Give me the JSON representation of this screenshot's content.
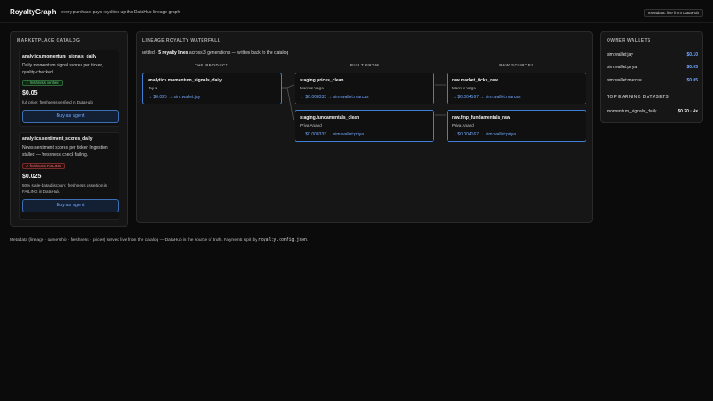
{
  "header": {
    "brand": "RoyaltyGraph",
    "tagline": "every purchase pays royalties up the DataHub lineage graph",
    "live_badge": "metadata: live from DataHub"
  },
  "catalog": {
    "title": "MARKETPLACE CATALOG",
    "items": [
      {
        "name": "analytics.momentum_signals_daily",
        "description": "Daily momentum signal scores per ticker, quality-checked.",
        "badge": "✓ freshness verified",
        "price": "$0.05",
        "price_note": "full price: freshness verified in DataHub",
        "button": "Buy as agent"
      },
      {
        "name": "analytics.sentiment_scores_daily",
        "description": "News-sentiment scores per ticker. Ingestion stalled — freshness check failing.",
        "badge": "✗ freshness FAILING",
        "price": "$0.025",
        "price_note": "50% stale-data discount: freshness assertion is FAILING in DataHub.",
        "button": "Buy as agent"
      }
    ]
  },
  "waterfall": {
    "title": "LINEAGE ROYALTY WATERFALL",
    "settled_prefix": "settled · ",
    "settled_bold": "5 royalty lines",
    "settled_suffix": " across 3 generations — written back to the catalog",
    "columns": [
      "THE PRODUCT",
      "BUILT FROM",
      "RAW SOURCES"
    ],
    "nodes": [
      {
        "name": "analytics.momentum_signals_daily",
        "owner": "Jay K",
        "payout": "→ $0.025 → sim:wallet:jay"
      },
      {
        "name": "staging.prices_clean",
        "owner": "Marcus Vega",
        "payout": "→ $0.008333 → sim:wallet:marcus"
      },
      {
        "name": "staging.fundamentals_clean",
        "owner": "Priya Anand",
        "payout": "→ $0.008333 → sim:wallet:priya"
      },
      {
        "name": "raw.market_ticks_raw",
        "owner": "Marcus Vega",
        "payout": "→ $0.004167 → sim:wallet:marcus"
      },
      {
        "name": "raw.fmp_fundamentals_raw",
        "owner": "Priya Anand",
        "payout": "→ $0.004167 → sim:wallet:priya"
      }
    ]
  },
  "owners": {
    "title": "OWNER WALLETS",
    "wallets": [
      {
        "name": "sim:wallet:jay",
        "amount": "$0.10"
      },
      {
        "name": "sim:wallet:priya",
        "amount": "$0.05"
      },
      {
        "name": "sim:wallet:marcus",
        "amount": "$0.05"
      }
    ],
    "top_title": "TOP EARNING DATASETS",
    "top": [
      {
        "name": "momentum_signals_daily",
        "value": "$0.20 · 4×"
      }
    ]
  },
  "footer": {
    "text": "Metadata (lineage · ownership · freshness · prices) served live from the catalog — DataHub is the source of truth. Payments split by ",
    "code": "royalty.config.json",
    "end": "."
  },
  "colors": {
    "accent": "#6fa7ff",
    "node_border": "#3f7fd6",
    "ok": "#6fd37f",
    "bad": "#ff7a7a"
  }
}
